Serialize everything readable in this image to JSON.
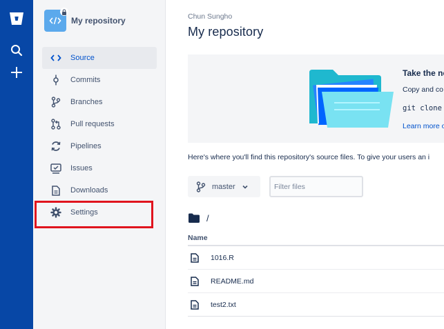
{
  "colors": {
    "rail": "#0747a6",
    "accent": "#0052cc",
    "highlight": "#e0141e",
    "repo_avatar": "#5ba9ec"
  },
  "rail": {
    "icons": [
      "bitbucket-logo-icon",
      "search-icon",
      "plus-icon"
    ]
  },
  "sidebar": {
    "repo_name": "My repository",
    "items": [
      {
        "label": "Source",
        "icon": "code-icon",
        "active": true
      },
      {
        "label": "Commits",
        "icon": "commit-icon"
      },
      {
        "label": "Branches",
        "icon": "branch-icon"
      },
      {
        "label": "Pull requests",
        "icon": "pull-request-icon"
      },
      {
        "label": "Pipelines",
        "icon": "pipelines-icon"
      },
      {
        "label": "Issues",
        "icon": "issues-icon"
      },
      {
        "label": "Downloads",
        "icon": "download-file-icon"
      },
      {
        "label": "Settings",
        "icon": "gear-icon",
        "highlighted": true
      }
    ]
  },
  "main": {
    "breadcrumb": "Chun Sungho",
    "title": "My repository",
    "banner": {
      "title": "Take the ne",
      "text": "Copy and co",
      "code": "git clone",
      "link": "Learn more o"
    },
    "info": "Here's where you'll find this repository's source files. To give your users an i",
    "branch": "master",
    "filter_placeholder": "Filter files",
    "path": "/",
    "table_header": "Name",
    "files": [
      "1016.R",
      "README.md",
      "test2.txt"
    ]
  }
}
